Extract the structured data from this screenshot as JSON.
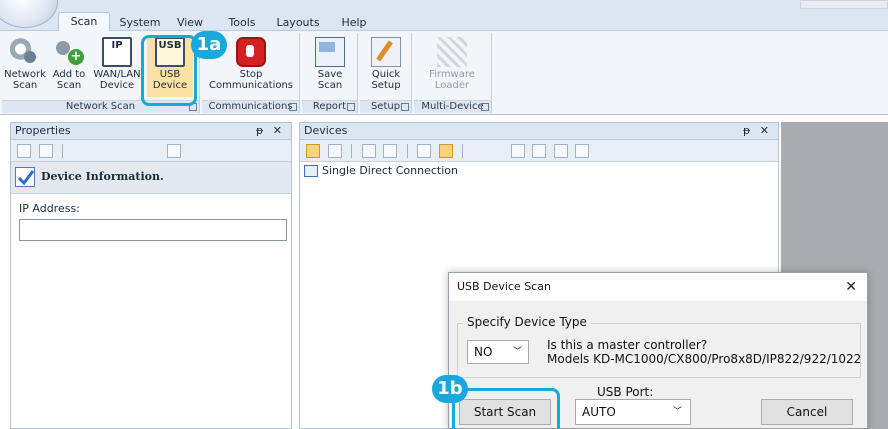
{
  "menu": {
    "tabs": [
      "Scan",
      "System",
      "View",
      "Tools",
      "Layouts",
      "Help"
    ]
  },
  "ribbon": {
    "buttons": {
      "network_scan": "Network Scan",
      "add_to_scan": "Add to Scan",
      "wan_lan_device": "WAN/LAN Device",
      "usb_device": "USB Device",
      "stop_communications": "Stop Communications",
      "save_scan": "Save Scan",
      "quick_setup": "Quick Setup",
      "firmware_loader": "Firmware Loader"
    },
    "icon_text": {
      "ip": "IP",
      "usb": "USB"
    },
    "groups": {
      "network_scan": "Network Scan",
      "communications": "Communications",
      "report": "Report",
      "setup": "Setup",
      "multi_device": "Multi-Device"
    }
  },
  "callouts": {
    "a": "1a",
    "b": "1b",
    "color": "#19a7dc"
  },
  "properties": {
    "title": "Properties",
    "controls": "ᵽ ✕",
    "header": "Device Information.",
    "ip_label": "IP Address:",
    "ip_value": ""
  },
  "devices": {
    "title": "Devices",
    "controls": "ᵽ ✕",
    "items": [
      "Single Direct Connection"
    ]
  },
  "dialog": {
    "title": "USB Device Scan",
    "close": "✕",
    "group_title": "Specify Device Type",
    "device_type_value": "NO",
    "question": "Is this a master controller?",
    "models": "Models KD-MC1000/CX800/Pro8x8D/IP822/922/1022",
    "usb_port_label": "USB Port:",
    "usb_port_value": "AUTO",
    "start_scan": "Start Scan",
    "cancel": "Cancel"
  }
}
